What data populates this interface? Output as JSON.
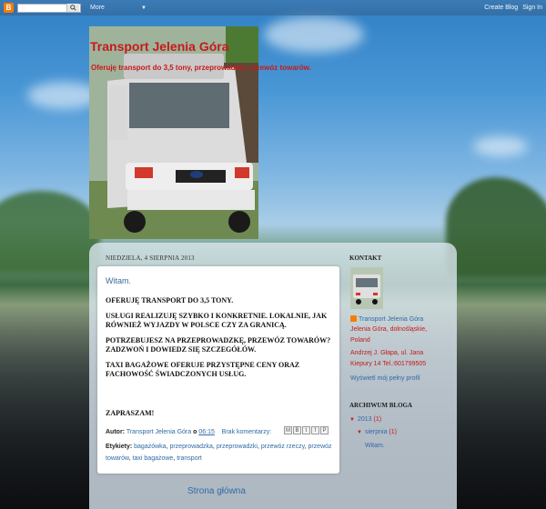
{
  "navbar": {
    "more_label": "More",
    "create_blog": "Create Blog",
    "sign_in": "Sign In"
  },
  "blog": {
    "title": "Transport Jelenia Góra",
    "description": "Oferuję transport do 3,5 tony, przeprowadzki, przewóz towarów."
  },
  "post": {
    "date": "NIEDZIELA, 4 SIERPNIA 2013",
    "title": "Witam.",
    "paragraphs": [
      "OFERUJĘ TRANSPORT DO 3,5 TONY.",
      "USŁUGI REALIZUJĘ SZYBKO I KONKRETNIE. LOKALNIE, JAK RÓWNIEŻ WYJAZDY W POLSCE CZY ZA GRANICĄ.",
      "POTRZEBUJESZ NA PRZEPROWADZKĘ, PRZEWÓZ TOWARÓW? ZADZWOŃ I DOWIEDZ SIĘ SZCZEGÓŁÓW.",
      "TAXI BAGAŻOWE OFERUJE PRZYSTĘPNE CENY ORAZ FACHOWOŚĆ ŚWIADCZONYCH USŁUG."
    ],
    "closing": "ZAPRASZAM!",
    "author_prefix": "Autor:",
    "author": "Transport Jelenia Góra",
    "time_prefix": "o",
    "time": "06:15",
    "comments": "Brak komentarzy:",
    "labels_prefix": "Etykiety:",
    "labels": [
      "bagażówka",
      "przeprowadzka",
      "przeprowadzki",
      "przewóz rzeczy",
      "przewóz towarów",
      "taxi bagażowe",
      "transport"
    ]
  },
  "home_link": "Strona główna",
  "sidebar": {
    "contact_heading": "KONTAKT",
    "profile_name": "Transport Jelenia Góra",
    "location_line1": "Jelenia Góra, dolnośląskie,",
    "location_line2": "Poland",
    "address_line1": "Andrzej J. Głapa, ul. Jana",
    "address_line2": "Kiepury 14 Tel.:601799505",
    "profile_link": "Wyświetl mój pełny profil",
    "archive_heading": "ARCHIWUM BLOGA",
    "archive_year": "2013",
    "archive_year_count": "(1)",
    "archive_month": "sierpnia",
    "archive_month_count": "(1)",
    "archive_post": "Witam."
  },
  "share_icons": [
    "email-icon",
    "blog-this-icon",
    "twitter-icon",
    "facebook-icon",
    "pinterest-icon"
  ]
}
